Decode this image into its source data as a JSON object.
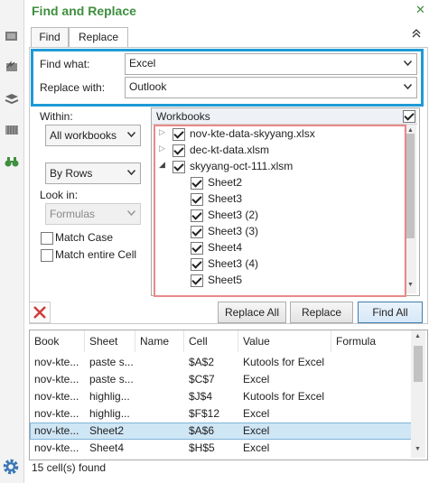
{
  "title": "Find and Replace",
  "tabs": [
    "Find",
    "Replace"
  ],
  "find_what": {
    "label": "Find what:",
    "value": "Excel"
  },
  "replace_with": {
    "label": "Replace with:",
    "value": "Outlook"
  },
  "within": {
    "label": "Within:",
    "value": "All workbooks"
  },
  "search": {
    "value": "By Rows"
  },
  "look_in": {
    "label": "Look in:",
    "value": "Formulas"
  },
  "match_case": {
    "label": "Match Case",
    "checked": false
  },
  "match_entire": {
    "label": "Match entire Cell",
    "checked": false
  },
  "workbooks": {
    "header": "Workbooks",
    "items": [
      {
        "label": "nov-kte-data-skyyang.xlsx",
        "checked": true
      },
      {
        "label": "dec-kt-data.xlsm",
        "checked": true
      },
      {
        "label": "skyyang-oct-111.xlsm",
        "checked": true
      },
      {
        "label": "Sheet2",
        "checked": true
      },
      {
        "label": "Sheet3",
        "checked": true
      },
      {
        "label": "Sheet3 (2)",
        "checked": true
      },
      {
        "label": "Sheet3 (3)",
        "checked": true
      },
      {
        "label": "Sheet4",
        "checked": true
      },
      {
        "label": "Sheet3 (4)",
        "checked": true
      },
      {
        "label": "Sheet5",
        "checked": true
      }
    ]
  },
  "buttons": {
    "replace_all": "Replace All",
    "replace": "Replace",
    "find_all": "Find All"
  },
  "results": {
    "columns": [
      "Book",
      "Sheet",
      "Name",
      "Cell",
      "Value",
      "Formula"
    ],
    "rows": [
      {
        "book": "nov-kte...",
        "sheet": "paste s...",
        "name": "",
        "cell": "$A$2",
        "value": "Kutools for Excel",
        "formula": ""
      },
      {
        "book": "nov-kte...",
        "sheet": "paste s...",
        "name": "",
        "cell": "$C$7",
        "value": "Excel",
        "formula": ""
      },
      {
        "book": "nov-kte...",
        "sheet": "highlig...",
        "name": "",
        "cell": "$J$4",
        "value": "Kutools for Excel",
        "formula": ""
      },
      {
        "book": "nov-kte...",
        "sheet": "highlig...",
        "name": "",
        "cell": "$F$12",
        "value": "Excel",
        "formula": ""
      },
      {
        "book": "nov-kte...",
        "sheet": "Sheet2",
        "name": "",
        "cell": "$A$6",
        "value": "Excel",
        "formula": "",
        "selected": true
      },
      {
        "book": "nov-kte...",
        "sheet": "Sheet4",
        "name": "",
        "cell": "$H$5",
        "value": "Excel",
        "formula": ""
      }
    ]
  },
  "status": "15 cell(s) found",
  "colors": {
    "accent_green": "#3f8f3f",
    "highlight_blue": "#1e9ad6",
    "highlight_red": "#e98a8a"
  }
}
